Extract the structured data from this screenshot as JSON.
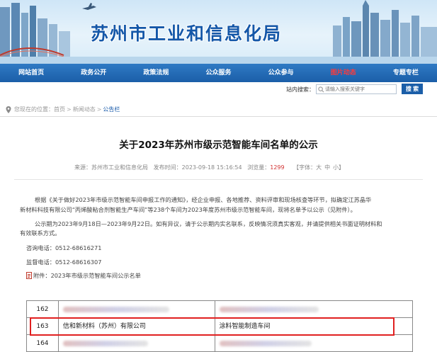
{
  "site": {
    "title": "苏州市工业和信息化局"
  },
  "nav": {
    "items": [
      "网站首页",
      "政务公开",
      "政策法规",
      "公众服务",
      "公众参与",
      "图片动态",
      "专题专栏"
    ],
    "active_index": 5
  },
  "search": {
    "label": "站内搜索：",
    "placeholder": "请输入搜索关键字",
    "button": "搜 索"
  },
  "breadcrumb": {
    "prefix": "您现在的位置：",
    "items": [
      "首页",
      "新闻动态",
      "公告栏"
    ],
    "separator": ">"
  },
  "article": {
    "title": "关于2023年苏州市级示范智能车间名单的公示",
    "meta": {
      "source_label": "来源：",
      "source": "苏州市工业和信息化局",
      "time_label": "发布时间：",
      "time": "2023-09-18 15:16:54",
      "views_label": "浏览量：",
      "views": "1299",
      "font_label": "【字体：",
      "font_large": "大",
      "font_medium": "中",
      "font_small": "小",
      "font_close": "】"
    },
    "para1_line1": "根据《关于做好2023年市级示范智能车间申报工作的通知》，经企业申报、各地推荐、资料评审和现场核查等环节，拟确定江苏晶华",
    "para1_line2": "新材料科技有限公司“丙烯酸粘合剂智能生产车间”等238个车间为2023年度苏州市级示范智能车间，现将名单予以公示（见附件）。",
    "para2_line1": "公示期为2023年9月18日—2023年9月22日。如有异议，请于公示期内实名联系，反映情况须真实客观，并请提供相关书面证明材料和",
    "para2_line2": "有效联系方式。",
    "consult": "咨询电话：0512-68616271",
    "supervise": "监督电话：0512-68616307",
    "attachment": "附件：2023年市级示范智能车间公示名单"
  },
  "table": {
    "rows": [
      {
        "num": "162",
        "company": "",
        "line": ""
      },
      {
        "num": "163",
        "company": "信和新材料（苏州）有限公司",
        "line": "涂料智能制造车间"
      },
      {
        "num": "164",
        "company": "",
        "line": ""
      }
    ]
  },
  "colors": {
    "brand_blue": "#1457a8",
    "nav_blue": "#1b5ea8",
    "active_red": "#ff3a3a",
    "highlight_red": "#e02020"
  }
}
